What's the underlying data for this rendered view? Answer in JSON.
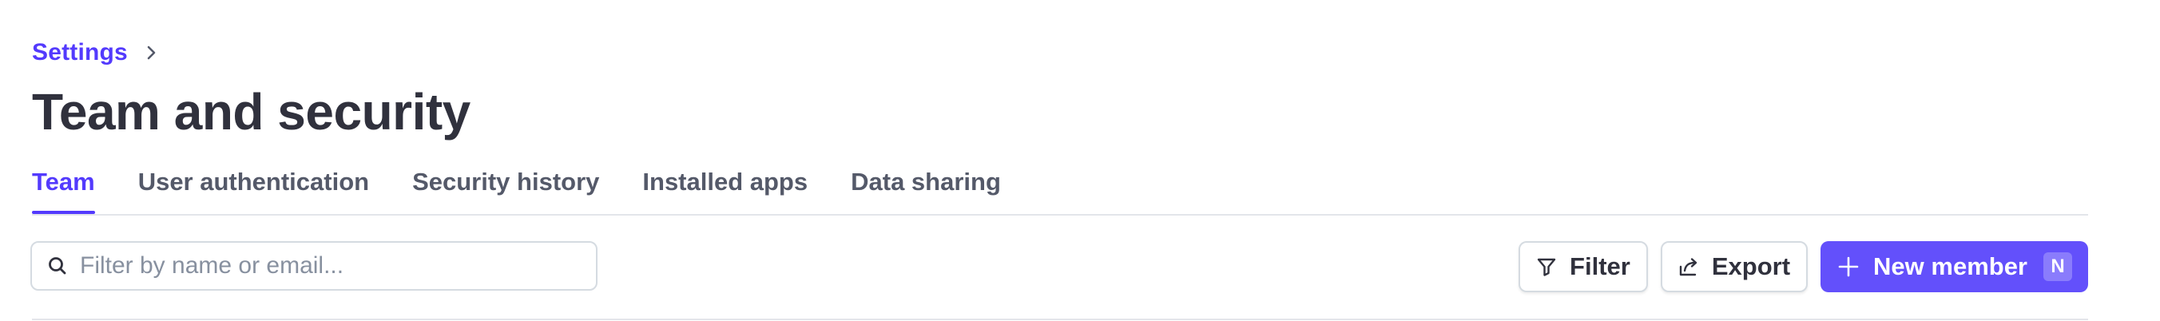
{
  "breadcrumb": {
    "parent_label": "Settings"
  },
  "page": {
    "title": "Team and security"
  },
  "tabs": [
    {
      "label": "Team",
      "active": true
    },
    {
      "label": "User authentication",
      "active": false
    },
    {
      "label": "Security history",
      "active": false
    },
    {
      "label": "Installed apps",
      "active": false
    },
    {
      "label": "Data sharing",
      "active": false
    }
  ],
  "search": {
    "placeholder": "Filter by name or email...",
    "value": "",
    "icon": "search-icon"
  },
  "toolbar": {
    "filter_label": "Filter",
    "filter_icon": "filter-icon",
    "export_label": "Export",
    "export_icon": "export-icon",
    "new_member_label": "New member",
    "new_member_icon": "plus-icon",
    "new_member_shortcut": "N"
  },
  "colors": {
    "accent": "#533afd",
    "primary_button": "#6350fb",
    "text": "#30313d",
    "muted_text": "#545969",
    "border": "#d5dbe1"
  }
}
